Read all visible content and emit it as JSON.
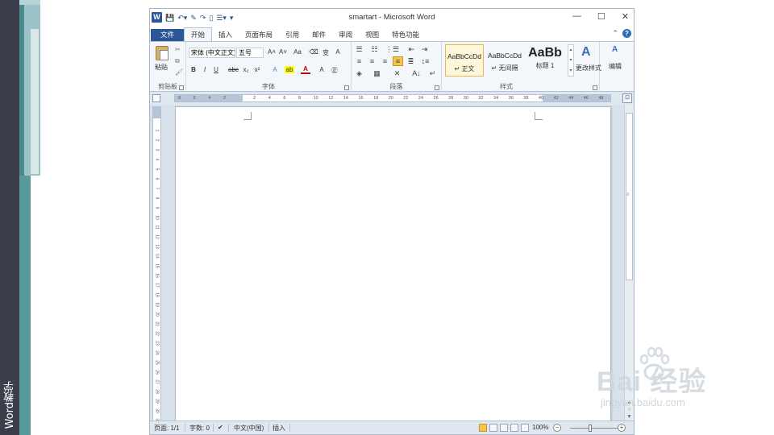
{
  "slide": {
    "side_label": "Word教学"
  },
  "window": {
    "title": "smartart - Microsoft Word",
    "controls": {
      "minimize": "—",
      "maximize": "☐",
      "close": "✕"
    }
  },
  "quick_access": {
    "logo": "W"
  },
  "tabs": [
    {
      "label": "文件"
    },
    {
      "label": "开始"
    },
    {
      "label": "插入"
    },
    {
      "label": "页面布局"
    },
    {
      "label": "引用"
    },
    {
      "label": "邮件"
    },
    {
      "label": "审阅"
    },
    {
      "label": "视图"
    },
    {
      "label": "特色功能"
    }
  ],
  "active_tab": "开始",
  "ribbon": {
    "clipboard": {
      "paste_label": "粘贴",
      "group_label": "剪贴板"
    },
    "font": {
      "font_name": "宋体 (中文正文)",
      "font_size": "五号",
      "group_label": "字体"
    },
    "paragraph": {
      "group_label": "段落"
    },
    "styles": {
      "items": [
        {
          "sample": "AaBbCcDd",
          "name": "↵ 正文"
        },
        {
          "sample": "AaBbCcDd",
          "name": "↵ 无间隔"
        },
        {
          "sample": "AaBb",
          "name": "标题 1"
        }
      ],
      "change_styles_label": "更改样式",
      "group_label": "样式"
    },
    "editing": {
      "label": "编辑"
    }
  },
  "ruler": {
    "ticks": [
      "8",
      "6",
      "4",
      "2",
      "",
      "2",
      "4",
      "6",
      "8",
      "10",
      "12",
      "14",
      "16",
      "18",
      "20",
      "22",
      "24",
      "26",
      "28",
      "30",
      "32",
      "34",
      "36",
      "38",
      "40",
      "42",
      "44",
      "46",
      "48"
    ]
  },
  "statusbar": {
    "page": "页面: 1/1",
    "words": "字数: 0",
    "language": "中文(中国)",
    "mode": "插入",
    "zoom": "100%"
  },
  "watermark": {
    "brand": "Bai   经验",
    "url": "jingyan.baidu.com"
  },
  "colors": {
    "accent": "#2b5797",
    "selected_style_border": "#e8b94a"
  }
}
